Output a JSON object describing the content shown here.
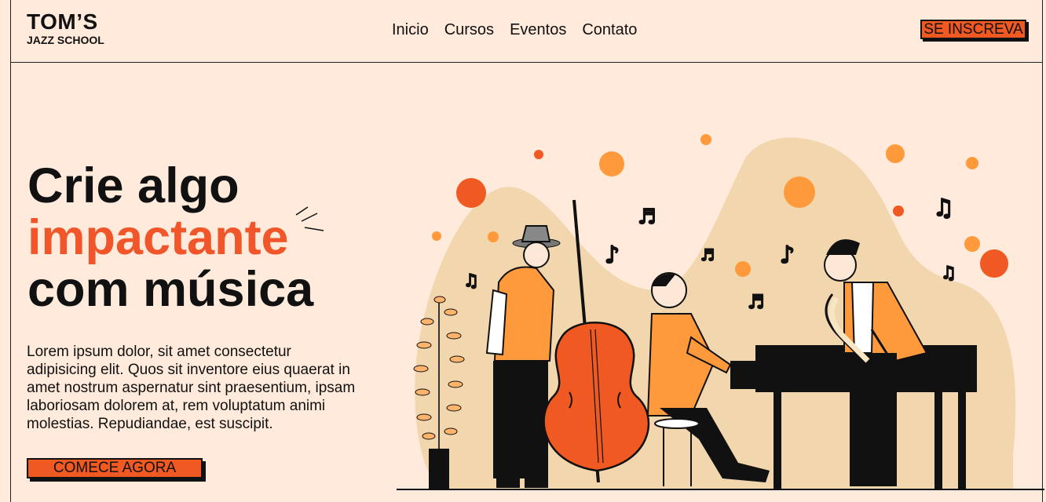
{
  "brand": {
    "name": "TOM’S",
    "sub": "JAZZ SCHOOL"
  },
  "nav": {
    "items": [
      {
        "label": "Inicio"
      },
      {
        "label": "Cursos"
      },
      {
        "label": "Eventos"
      },
      {
        "label": "Contato"
      }
    ]
  },
  "header_cta": "SE INSCREVA",
  "hero": {
    "line1": "Crie algo",
    "line2": "impactante",
    "line3": "com música",
    "description": "Lorem ipsum dolor, sit amet consectetur adipisicing elit. Quos sit inventore eius quaerat in amet nostrum aspernatur sint praesentium, ipsam laboriosam dolorem at, rem voluptatum animi molestias. Repudiandae, est suscipit.",
    "cta": "COMECE AGORA"
  },
  "colors": {
    "accent": "#f05a22",
    "background": "#ffeadb",
    "orange_light": "#ff9a3c",
    "blob": "#f1d6ae"
  }
}
